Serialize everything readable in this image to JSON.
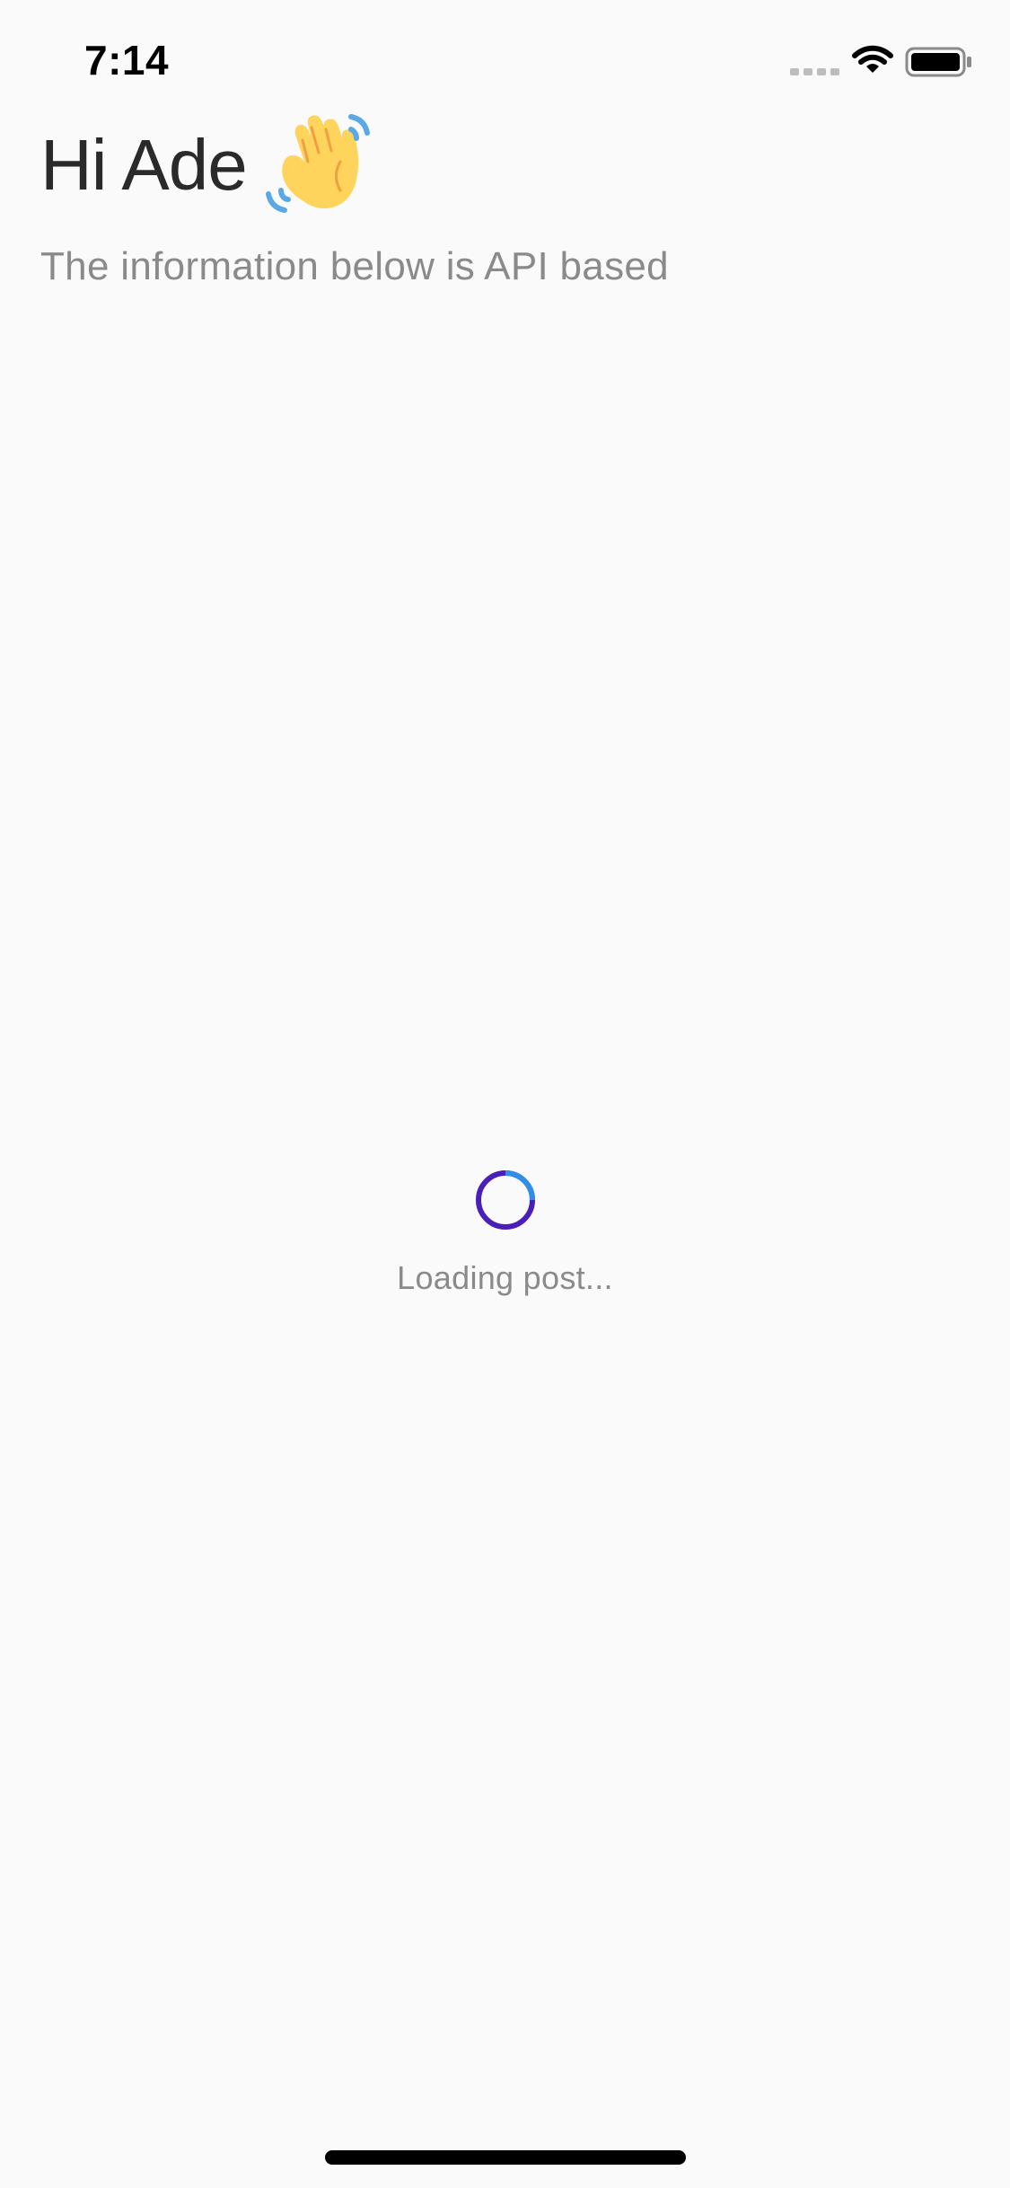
{
  "status_bar": {
    "time": "7:14",
    "icons": [
      "signal-dots-icon",
      "wifi-icon",
      "battery-icon"
    ]
  },
  "header": {
    "greeting": "Hi Ade",
    "greeting_icon": "waving-hand-icon",
    "subtitle": "The information below is API based"
  },
  "loader": {
    "text": "Loading post...",
    "spinner_icon": "loading-spinner-icon"
  },
  "colors": {
    "background": "#fafafa",
    "title": "#2a2a2a",
    "muted_text": "#8a8a8a",
    "spinner_primary": "#4a1fb8",
    "spinner_accent": "#2f8fe6",
    "wave_hand": "#ffd45c",
    "wave_lines": "#5aa8e6"
  }
}
